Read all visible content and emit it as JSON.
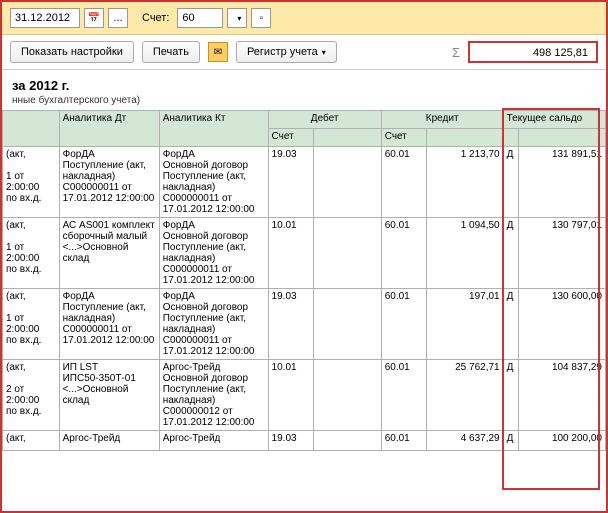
{
  "topbar": {
    "date": "31.12.2012",
    "account_label": "Счет:",
    "account_value": "60"
  },
  "toolbar": {
    "show_settings": "Показать настройки",
    "print": "Печать",
    "register": "Регистр учета",
    "sigma": "Σ",
    "total": "498 125,81"
  },
  "header": {
    "title": "за 2012 г.",
    "subtitle": "нные бухгалтерского учета)"
  },
  "columns": {
    "analytics_dt": "Аналитика Дт",
    "analytics_kt": "Аналитика Кт",
    "debit": "Дебет",
    "credit": "Кредит",
    "balance": "Текущее сальдо",
    "schet": "Счет"
  },
  "rows": [
    {
      "left": "(акт,\n\n1 от\n2:00:00\nпо вх.д.",
      "adt": "ФорДА\nПоступление (акт, накладная) С000000011 от 17.01.2012 12:00:00",
      "akt": "ФорДА\nОсновной договор\nПоступление (акт, накладная) С000000011 от 17.01.2012 12:00:00",
      "schet1": "19.03",
      "deb": "",
      "schet2": "60.01",
      "cred": "1 213,70",
      "dc": "Д",
      "bal": "131 891,51"
    },
    {
      "left": "(акт,\n\n1 от\n2:00:00\nпо вх.д.",
      "adt": "АС AS001 комплект сборочный малый\n<...>Основной склад",
      "akt": "ФорДА\nОсновной договор\nПоступление (акт, накладная) С000000011 от 17.01.2012 12:00:00",
      "schet1": "10.01",
      "deb": "",
      "schet2": "60.01",
      "cred": "1 094,50",
      "dc": "Д",
      "bal": "130 797,01"
    },
    {
      "left": "(акт,\n\n1 от\n2:00:00\nпо вх.д.",
      "adt": "ФорДА\nПоступление (акт, накладная) С000000011 от 17.01.2012 12:00:00",
      "akt": "ФорДА\nОсновной договор\nПоступление (акт, накладная) С000000011 от 17.01.2012 12:00:00",
      "schet1": "19.03",
      "deb": "",
      "schet2": "60.01",
      "cred": "197,01",
      "dc": "Д",
      "bal": "130 600,00"
    },
    {
      "left": "(акт,\n\n2 от\n2:00:00\nпо вх.д.",
      "adt": "ИП LST\nИПС50-350Т-01\n<...>Основной склад",
      "akt": "Аргос-Трейд\nОсновной договор\nПоступление (акт, накладная) С000000012 от 17.01.2012 12:00:00",
      "schet1": "10.01",
      "deb": "",
      "schet2": "60.01",
      "cred": "25 762,71",
      "dc": "Д",
      "bal": "104 837,29"
    },
    {
      "left": "(акт,",
      "adt": "Аргос-Трейд",
      "akt": "Аргос-Трейд",
      "schet1": "19.03",
      "deb": "",
      "schet2": "60.01",
      "cred": "4 637,29",
      "dc": "Д",
      "bal": "100 200,00"
    }
  ]
}
